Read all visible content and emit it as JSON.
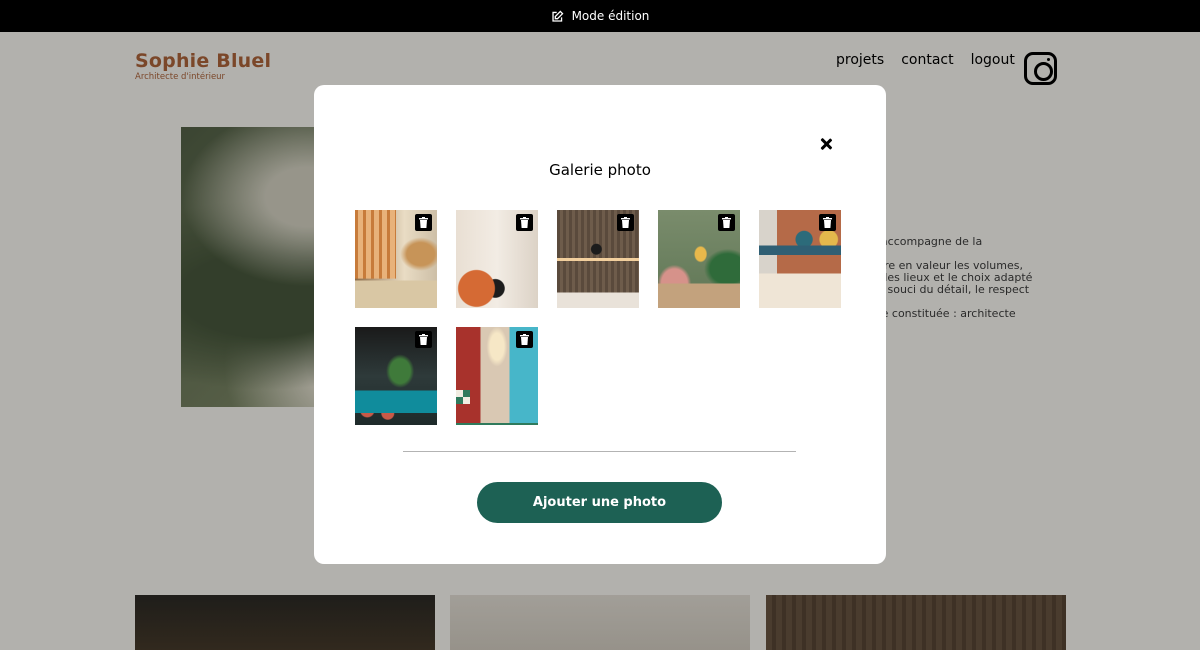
{
  "edit_bar": {
    "icon": "edit-icon",
    "label": "Mode édition"
  },
  "header": {
    "brand_name": "Sophie Bluel",
    "brand_subtitle": "Architecte d'intérieur",
    "nav": [
      "projets",
      "contact",
      "logout"
    ],
    "social_icon": "instagram-icon"
  },
  "about": {
    "paragraphs": [
      "ous accompagne de la",
      "mettre en valeur les volumes,\nprit des lieux et le choix adapté\nns le souci du détail, le respect",
      "t-être constituée : architecte"
    ]
  },
  "modal": {
    "title": "Galerie photo",
    "photos": [
      {
        "alt": "photo-1",
        "action_icon": "trash-icon"
      },
      {
        "alt": "photo-2",
        "action_icon": "trash-icon"
      },
      {
        "alt": "photo-3",
        "action_icon": "trash-icon"
      },
      {
        "alt": "photo-4",
        "action_icon": "trash-icon"
      },
      {
        "alt": "photo-5",
        "action_icon": "trash-icon"
      },
      {
        "alt": "photo-6",
        "action_icon": "trash-icon"
      },
      {
        "alt": "photo-7",
        "action_icon": "trash-icon"
      }
    ],
    "add_button_label": "Ajouter une photo",
    "close_icon": "close-icon"
  },
  "colors": {
    "brand": "#b1663c",
    "primary_button": "#1d6154",
    "edit_bar": "#000000",
    "page_background": "#fffef8"
  }
}
